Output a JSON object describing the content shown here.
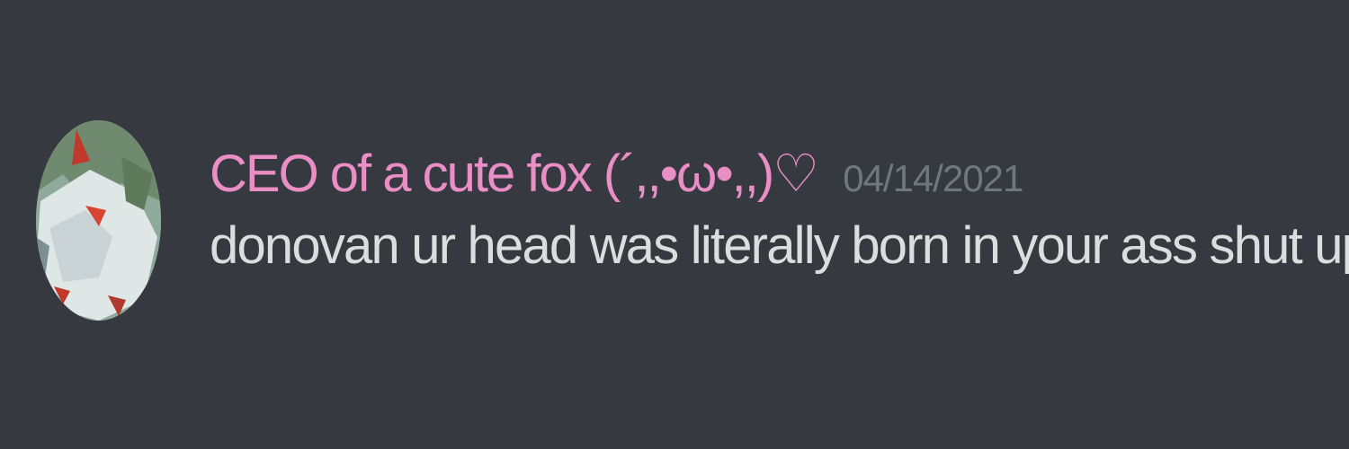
{
  "message": {
    "username": "CEO of a cute fox (´,,•ω•,,)♡",
    "timestamp": "04/14/2021",
    "text": "donovan ur head was literally born in your ass shut up"
  },
  "colors": {
    "background": "#36393f",
    "username": "#e98fc6",
    "timestamp": "#72767d",
    "text": "#dcddde"
  },
  "icons": {
    "avatar": "fox-avatar-image"
  }
}
